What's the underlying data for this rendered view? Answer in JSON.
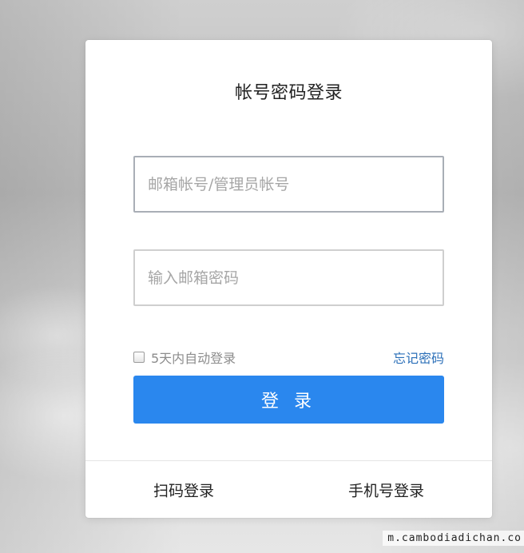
{
  "login": {
    "title": "帐号密码登录",
    "account_placeholder": "邮箱帐号/管理员帐号",
    "password_placeholder": "输入邮箱密码",
    "remember_label": "5天内自动登录",
    "forgot_password_label": "忘记密码",
    "login_button_label": "登 录",
    "qr_login_label": "扫码登录",
    "phone_login_label": "手机号登录"
  },
  "watermark": {
    "text": "m.cambodiadichan.co"
  },
  "colors": {
    "primary_button": "#2a87ee",
    "link": "#2b6fb8"
  }
}
